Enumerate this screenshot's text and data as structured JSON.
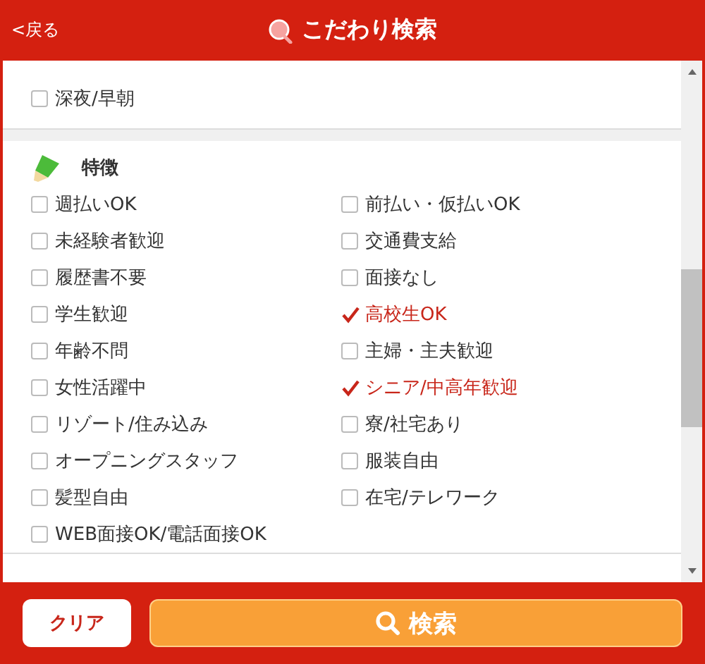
{
  "header": {
    "back": "<戻る",
    "title": "こだわり検索"
  },
  "sections": [
    {
      "items": [
        {
          "label": "深夜/早朝",
          "checked": false
        }
      ]
    },
    {
      "title": "特徴",
      "items": [
        {
          "label": "週払いOK",
          "checked": false
        },
        {
          "label": "前払い・仮払いOK",
          "checked": false
        },
        {
          "label": "未経験者歓迎",
          "checked": false
        },
        {
          "label": "交通費支給",
          "checked": false
        },
        {
          "label": "履歴書不要",
          "checked": false
        },
        {
          "label": "面接なし",
          "checked": false
        },
        {
          "label": "学生歓迎",
          "checked": false
        },
        {
          "label": "高校生OK",
          "checked": true
        },
        {
          "label": "年齢不問",
          "checked": false
        },
        {
          "label": "主婦・主夫歓迎",
          "checked": false
        },
        {
          "label": "女性活躍中",
          "checked": false
        },
        {
          "label": "シニア/中高年歓迎",
          "checked": true
        },
        {
          "label": "リゾート/住み込み",
          "checked": false
        },
        {
          "label": "寮/社宅あり",
          "checked": false
        },
        {
          "label": "オープニングスタッフ",
          "checked": false
        },
        {
          "label": "服装自由",
          "checked": false
        },
        {
          "label": "髪型自由",
          "checked": false
        },
        {
          "label": "在宅/テレワーク",
          "checked": false
        },
        {
          "label": "WEB面接OK/電話面接OK",
          "checked": false
        }
      ]
    }
  ],
  "footer": {
    "clear": "クリア",
    "search": "検索"
  }
}
